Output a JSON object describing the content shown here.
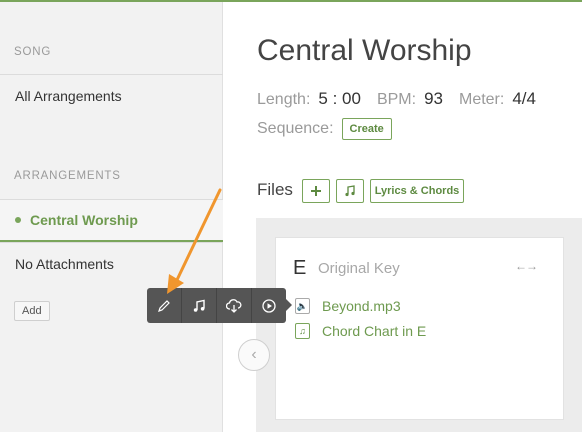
{
  "sidebar": {
    "song_section": "SONG",
    "all_arrangements": "All Arrangements",
    "arrangements_section": "ARRANGEMENTS",
    "items": [
      {
        "label": "Central Worship",
        "active": true
      },
      {
        "label": "No Attachments",
        "active": false
      }
    ],
    "add_label": "Add"
  },
  "main": {
    "title": "Central Worship",
    "length_label": "Length:",
    "length_value": "5 : 00",
    "bpm_label": "BPM:",
    "bpm_value": "93",
    "meter_label": "Meter:",
    "meter_value": "4/4",
    "sequence_label": "Sequence:",
    "create_label": "Create",
    "files_label": "Files",
    "add_file_icon": "plus-icon",
    "music_icon": "music-note-icon",
    "lyrics_chords_label": "Lyrics & Chords"
  },
  "card": {
    "key": "E",
    "key_label": "Original Key",
    "swap_icon": "left-right-arrows-icon",
    "files": [
      {
        "name": "Beyond.mp3",
        "icon": "audio-file-icon"
      },
      {
        "name": "Chord Chart in E",
        "icon": "chord-chart-icon"
      }
    ]
  },
  "toolbar": {
    "buttons": [
      "pencil-icon",
      "music-note-icon",
      "cloud-download-icon",
      "play-icon"
    ]
  },
  "colors": {
    "accent": "#7aa55b",
    "toolbar_bg": "#555555",
    "annotation_arrow": "#f0962e"
  }
}
